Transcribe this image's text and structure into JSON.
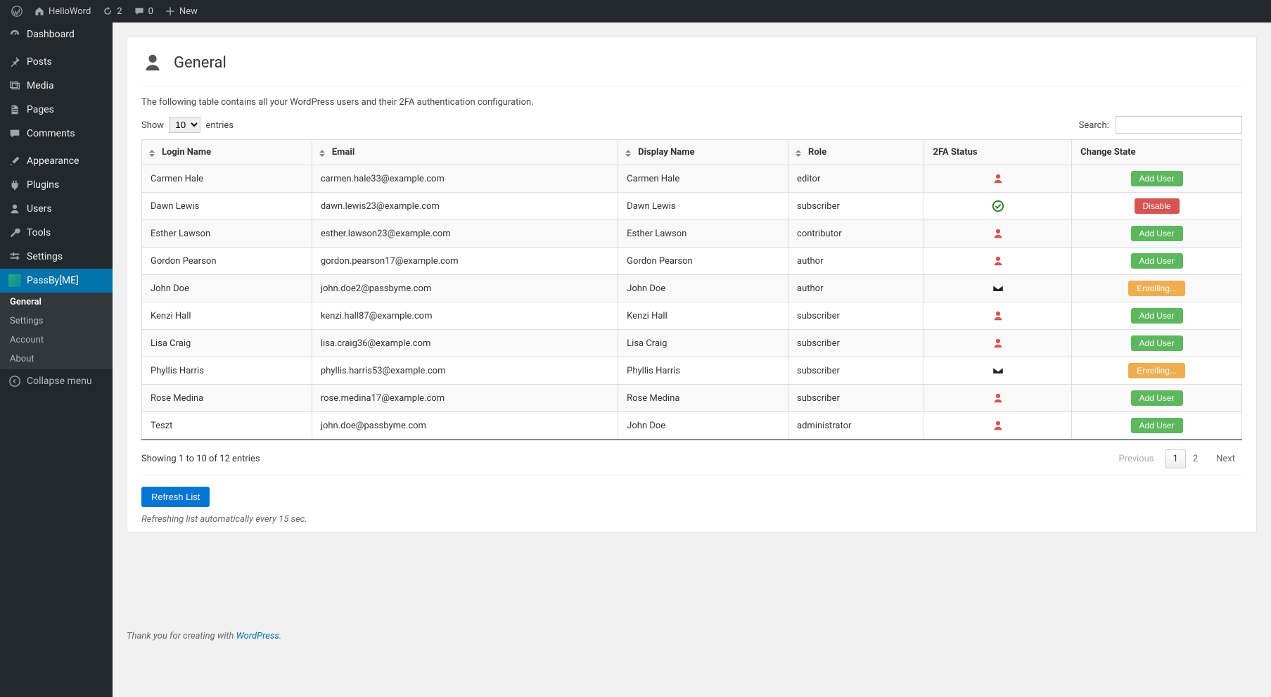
{
  "adminbar": {
    "site_name": "HelloWord",
    "updates_count": "2",
    "comments_count": "0",
    "new_label": "New"
  },
  "sidebar": {
    "items": [
      {
        "label": "Dashboard",
        "icon": "dashboard"
      },
      {
        "label": "Posts",
        "icon": "pin"
      },
      {
        "label": "Media",
        "icon": "media"
      },
      {
        "label": "Pages",
        "icon": "pages"
      },
      {
        "label": "Comments",
        "icon": "comment"
      },
      {
        "label": "Appearance",
        "icon": "brush"
      },
      {
        "label": "Plugins",
        "icon": "plug"
      },
      {
        "label": "Users",
        "icon": "person"
      },
      {
        "label": "Tools",
        "icon": "wrench"
      },
      {
        "label": "Settings",
        "icon": "sliders"
      },
      {
        "label": "PassBy[ME]",
        "icon": "passby",
        "active": true
      }
    ],
    "submenu": [
      {
        "label": "General",
        "active": true
      },
      {
        "label": "Settings"
      },
      {
        "label": "Account"
      },
      {
        "label": "About"
      }
    ],
    "collapse_label": "Collapse menu"
  },
  "page": {
    "title": "General",
    "description": "The following table contains all your WordPress users and their 2FA authentication configuration.",
    "show_label": "Show",
    "entries_label": "entries",
    "entries_value": "10",
    "search_label": "Search:",
    "columns": {
      "login": "Login Name",
      "email": "Email",
      "display": "Display Name",
      "role": "Role",
      "status": "2FA Status",
      "change": "Change State"
    },
    "rows": [
      {
        "login": "Carmen Hale",
        "email": "carmen.hale33@example.com",
        "display": "Carmen Hale",
        "role": "editor",
        "status": "person",
        "action": "add"
      },
      {
        "login": "Dawn Lewis",
        "email": "dawn.lewis23@example.com",
        "display": "Dawn Lewis",
        "role": "subscriber",
        "status": "check",
        "action": "disable"
      },
      {
        "login": "Esther Lawson",
        "email": "esther.lawson23@example.com",
        "display": "Esther Lawson",
        "role": "contributor",
        "status": "person",
        "action": "add"
      },
      {
        "login": "Gordon Pearson",
        "email": "gordon.pearson17@example.com",
        "display": "Gordon Pearson",
        "role": "author",
        "status": "person",
        "action": "add"
      },
      {
        "login": "John Doe",
        "email": "john.doe2@passbyme.com",
        "display": "John Doe",
        "role": "author",
        "status": "envelope",
        "action": "enrolling"
      },
      {
        "login": "Kenzi Hall",
        "email": "kenzi.hall87@example.com",
        "display": "Kenzi Hall",
        "role": "subscriber",
        "status": "person",
        "action": "add"
      },
      {
        "login": "Lisa Craig",
        "email": "lisa.craig36@example.com",
        "display": "Lisa Craig",
        "role": "subscriber",
        "status": "person",
        "action": "add"
      },
      {
        "login": "Phyllis Harris",
        "email": "phyllis.harris53@example.com",
        "display": "Phyllis Harris",
        "role": "subscriber",
        "status": "envelope",
        "action": "enrolling"
      },
      {
        "login": "Rose Medina",
        "email": "rose.medina17@example.com",
        "display": "Rose Medina",
        "role": "subscriber",
        "status": "person",
        "action": "add"
      },
      {
        "login": "Teszt",
        "email": "john.doe@passbyme.com",
        "display": "John Doe",
        "role": "administrator",
        "status": "person",
        "action": "add"
      }
    ],
    "actions": {
      "add": "Add User",
      "disable": "Disable",
      "enrolling": "Enrolling..."
    },
    "result_info": "Showing 1 to 10 of 12 entries",
    "pagination": {
      "previous": "Previous",
      "pages": [
        "1",
        "2"
      ],
      "next": "Next",
      "current": "1"
    },
    "refresh_button": "Refresh List",
    "refresh_note": "Refreshing list automatically every 15 sec.",
    "footer_thanks_prefix": "Thank you for creating with ",
    "footer_thanks_link": "WordPress."
  }
}
